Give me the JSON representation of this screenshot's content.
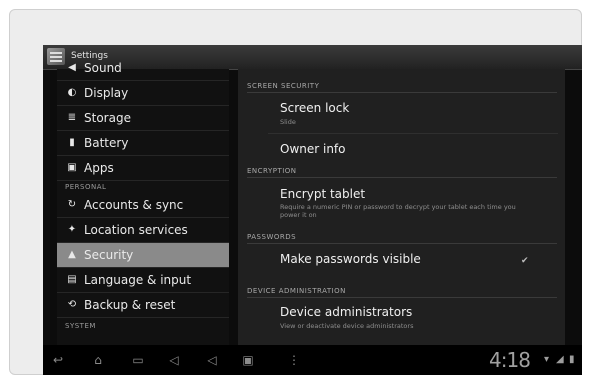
{
  "app": {
    "title": "Settings"
  },
  "left_pane": {
    "items": [
      {
        "label": "Sound",
        "icon": "speaker-icon"
      },
      {
        "label": "Display",
        "icon": "brightness-icon"
      },
      {
        "label": "Storage",
        "icon": "storage-icon"
      },
      {
        "label": "Battery",
        "icon": "battery-icon"
      },
      {
        "label": "Apps",
        "icon": "apps-icon"
      },
      {
        "label": "Accounts & sync",
        "icon": "sync-icon"
      },
      {
        "label": "Location services",
        "icon": "location-icon"
      },
      {
        "label": "Security",
        "icon": "lock-icon",
        "selected": true
      },
      {
        "label": "Language & input",
        "icon": "keyboard-icon"
      },
      {
        "label": "Backup & reset",
        "icon": "reset-icon"
      }
    ],
    "headers": {
      "personal": "PERSONAL",
      "system": "SYSTEM"
    }
  },
  "right_pane": {
    "screen_security": {
      "header": "SCREEN SECURITY",
      "screen_lock": {
        "title": "Screen lock",
        "summary": "Slide"
      },
      "owner_info": {
        "title": "Owner info"
      }
    },
    "encryption": {
      "header": "ENCRYPTION",
      "encrypt_tablet": {
        "title": "Encrypt tablet",
        "summary": "Require a numeric PIN or password to decrypt your tablet each time you power it on"
      }
    },
    "passwords": {
      "header": "PASSWORDS",
      "make_visible": {
        "title": "Make passwords visible",
        "checked": true
      }
    },
    "device_administration": {
      "header": "DEVICE ADMINISTRATION",
      "device_admins": {
        "title": "Device administrators",
        "summary": "View or deactivate device administrators"
      }
    }
  },
  "navbar": {
    "icons": [
      "back-icon",
      "home-icon",
      "recent-apps-icon",
      "volume-down-icon",
      "volume-up-icon",
      "screenshot-icon",
      "menu-icon"
    ],
    "time_prefix": "4:",
    "time": "18",
    "status_icons": [
      "wifi-icon",
      "signal-icon",
      "battery-icon"
    ]
  },
  "colors": {
    "selected_bg": "#8a8a8a",
    "screen_bg": "#0c0c0c",
    "card_bg": "#ededed"
  }
}
